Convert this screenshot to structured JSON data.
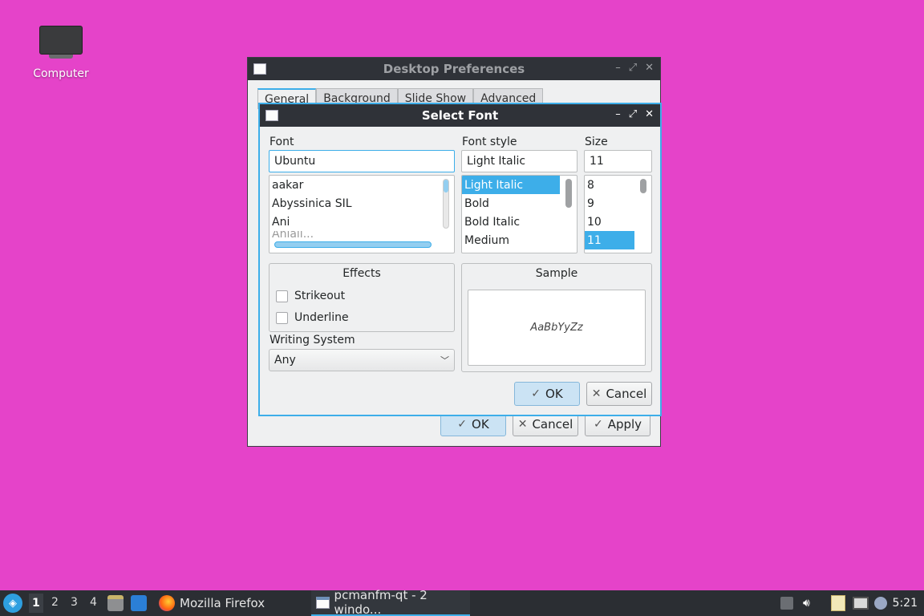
{
  "desktop": {
    "computer_label": "Computer"
  },
  "prefs_window": {
    "title": "Desktop Preferences",
    "tabs": [
      "General",
      "Background",
      "Slide Show",
      "Advanced"
    ],
    "ok_label": "OK",
    "cancel_label": "Cancel",
    "apply_label": "Apply"
  },
  "font_dialog": {
    "title": "Select Font",
    "font_label": "Font",
    "font_value": "Ubuntu",
    "font_list": [
      "aakar",
      "Abyssinica SIL",
      "Ani",
      "Anjali..."
    ],
    "style_label": "Font style",
    "style_value": "Light Italic",
    "style_list": [
      "Light Italic",
      "Bold",
      "Bold Italic",
      "Medium"
    ],
    "size_label": "Size",
    "size_value": "11",
    "size_list": [
      "8",
      "9",
      "10",
      "11"
    ],
    "effects_title": "Effects",
    "strikeout_label": "Strikeout",
    "underline_label": "Underline",
    "writing_system_label": "Writing System",
    "writing_system_value": "Any",
    "sample_title": "Sample",
    "sample_text": "AaBbYyZz",
    "ok_label": "OK",
    "cancel_label": "Cancel"
  },
  "taskbar": {
    "desktops": [
      "1",
      "2",
      "3",
      "4"
    ],
    "firefox_label": "Mozilla Firefox",
    "pcmanfm_label": "pcmanfm-qt - 2 windo...",
    "clock": "5:21"
  },
  "colors": {
    "desktop_bg": "#e543c9",
    "accent": "#3daee9",
    "titlebar": "#2f3238"
  }
}
